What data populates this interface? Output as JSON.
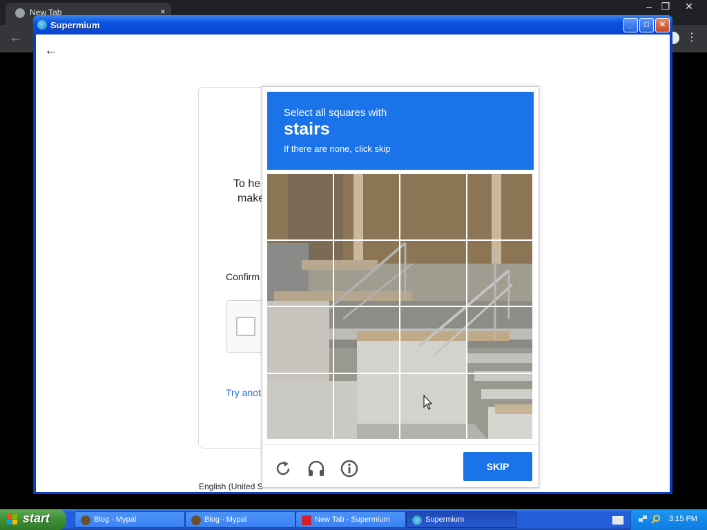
{
  "background_browser": {
    "tab_title": "New Tab",
    "tab_close": "×",
    "window_controls": [
      "–",
      "❐",
      "✕"
    ]
  },
  "window": {
    "title": "Supermium",
    "controls": [
      "_",
      "□",
      "✕"
    ]
  },
  "page": {
    "back_icon": "←",
    "description_line1": "To he",
    "description_line2": "make",
    "confirm_label": "Confirm",
    "try_another": "Try anot",
    "language": "English (United S"
  },
  "captcha": {
    "prompt": "Select all squares with",
    "keyword": "stairs",
    "hint": "If there are none, click skip",
    "grid_rows": 4,
    "grid_cols": 4,
    "footer_icons": [
      "reload-icon",
      "headphones-icon",
      "info-icon"
    ],
    "skip_label": "SKIP",
    "accent": "#1a73e8"
  },
  "taskbar": {
    "start_label": "start",
    "buttons": [
      {
        "label": "Blog - Mypal",
        "icon": "mypal-icon"
      },
      {
        "label": "Blog - Mypal",
        "icon": "mypal-icon"
      },
      {
        "label": "New Tab - Supermium",
        "icon": "supermium-icon"
      },
      {
        "label": "Supermium",
        "icon": "supermium-icon"
      }
    ],
    "clock": "3:15 PM"
  }
}
